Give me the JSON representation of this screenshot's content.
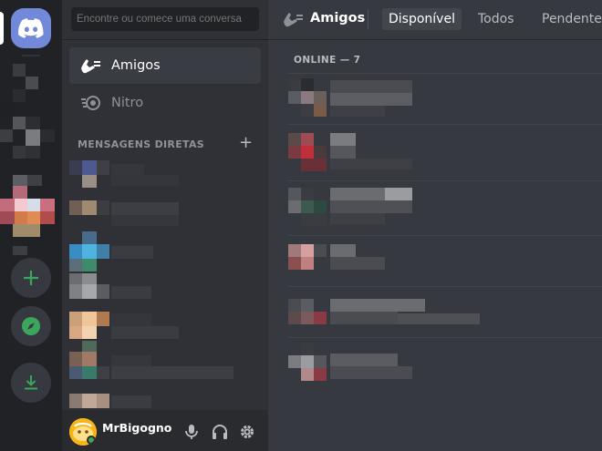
{
  "search": {
    "placeholder": "Encontre ou comece uma conversa"
  },
  "nav": {
    "friends_label": "Amigos",
    "nitro_label": "Nitro"
  },
  "dm_section": {
    "title": "MENSAGENS DIRETAS",
    "add_symbol": "+"
  },
  "user": {
    "name": "MrBigogno"
  },
  "topbar": {
    "title": "Amigos",
    "tabs": [
      {
        "label": "Disponível",
        "active": true
      },
      {
        "label": "Todos",
        "active": false
      },
      {
        "label": "Pendente",
        "active": false
      }
    ]
  },
  "friends": {
    "online_label": "ONLINE — 7"
  },
  "colors": {
    "blurple": "#7289da",
    "green": "#3ba55c",
    "rail_bg": "#202225",
    "side_bg": "#2f3136",
    "main_bg": "#36393f"
  },
  "icons": [
    "discord-logo-icon",
    "add-server-icon",
    "explore-icon",
    "download-icon",
    "friends-icon",
    "nitro-icon",
    "mic-icon",
    "headphones-icon",
    "gear-icon"
  ]
}
